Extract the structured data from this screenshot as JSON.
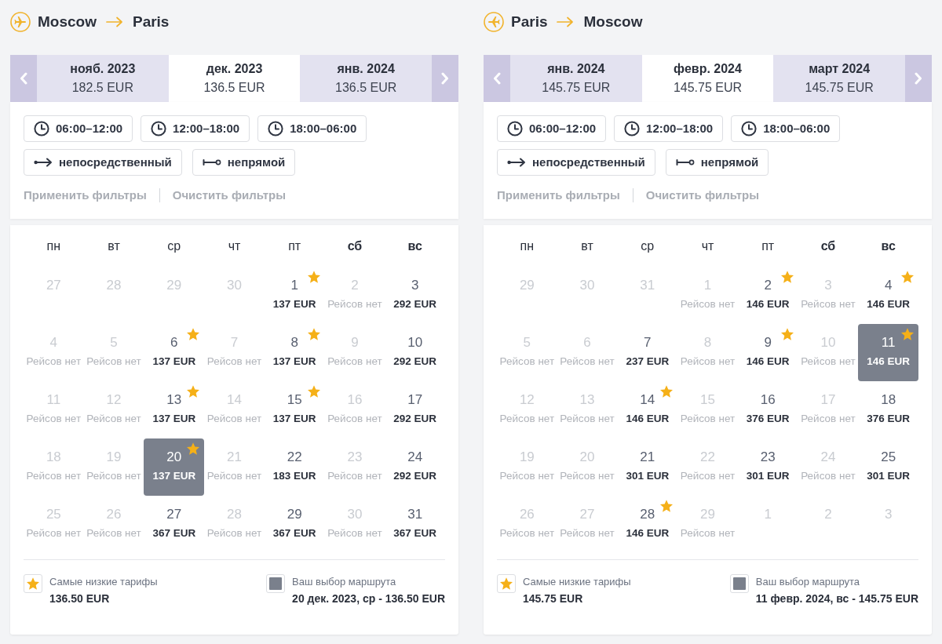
{
  "panels": [
    {
      "kind": "outbound",
      "route": {
        "from": "Moscow",
        "to": "Paris"
      },
      "tabs": [
        {
          "month": "нояб. 2023",
          "price": "182.5 EUR",
          "selected": false
        },
        {
          "month": "дек. 2023",
          "price": "136.5 EUR",
          "selected": true
        },
        {
          "month": "янв. 2024",
          "price": "136.5 EUR",
          "selected": false
        }
      ],
      "time_filters": [
        {
          "kind": "time",
          "label": "06:00–12:00"
        },
        {
          "kind": "time",
          "label": "12:00–18:00"
        },
        {
          "kind": "time",
          "label": "18:00–06:00"
        }
      ],
      "stop_filters": [
        {
          "kind": "direct",
          "label": "непосредственный"
        },
        {
          "kind": "indirect",
          "label": "непрямой"
        }
      ],
      "actions": [
        {
          "label": "Применить фильтры",
          "disabled": true
        },
        {
          "label": "Очистить фильтры",
          "disabled": true
        }
      ],
      "weekdays": [
        {
          "label": "пн",
          "weekend": false
        },
        {
          "label": "вт",
          "weekend": false
        },
        {
          "label": "ср",
          "weekend": false
        },
        {
          "label": "чт",
          "weekend": false
        },
        {
          "label": "пт",
          "weekend": false
        },
        {
          "label": "сб",
          "weekend": true
        },
        {
          "label": "вс",
          "weekend": true
        }
      ],
      "days": [
        {
          "day": "27",
          "kind": "outside",
          "lowest": false,
          "selected": false
        },
        {
          "day": "28",
          "kind": "outside",
          "lowest": false,
          "selected": false
        },
        {
          "day": "29",
          "kind": "outside",
          "lowest": false,
          "selected": false
        },
        {
          "day": "30",
          "kind": "outside",
          "lowest": false,
          "selected": false
        },
        {
          "day": "1",
          "kind": "price",
          "text": "137 EUR",
          "lowest": true,
          "selected": false
        },
        {
          "day": "2",
          "kind": "none",
          "text": "Рейсов нет",
          "lowest": false,
          "selected": false
        },
        {
          "day": "3",
          "kind": "price",
          "text": "292 EUR",
          "lowest": false,
          "selected": false
        },
        {
          "day": "4",
          "kind": "none",
          "text": "Рейсов нет",
          "lowest": false,
          "selected": false
        },
        {
          "day": "5",
          "kind": "none",
          "text": "Рейсов нет",
          "lowest": false,
          "selected": false
        },
        {
          "day": "6",
          "kind": "price",
          "text": "137 EUR",
          "lowest": true,
          "selected": false
        },
        {
          "day": "7",
          "kind": "none",
          "text": "Рейсов нет",
          "lowest": false,
          "selected": false
        },
        {
          "day": "8",
          "kind": "price",
          "text": "137 EUR",
          "lowest": true,
          "selected": false
        },
        {
          "day": "9",
          "kind": "none",
          "text": "Рейсов нет",
          "lowest": false,
          "selected": false
        },
        {
          "day": "10",
          "kind": "price",
          "text": "292 EUR",
          "lowest": false,
          "selected": false
        },
        {
          "day": "11",
          "kind": "none",
          "text": "Рейсов нет",
          "lowest": false,
          "selected": false
        },
        {
          "day": "12",
          "kind": "none",
          "text": "Рейсов нет",
          "lowest": false,
          "selected": false
        },
        {
          "day": "13",
          "kind": "price",
          "text": "137 EUR",
          "lowest": true,
          "selected": false
        },
        {
          "day": "14",
          "kind": "none",
          "text": "Рейсов нет",
          "lowest": false,
          "selected": false
        },
        {
          "day": "15",
          "kind": "price",
          "text": "137 EUR",
          "lowest": true,
          "selected": false
        },
        {
          "day": "16",
          "kind": "none",
          "text": "Рейсов нет",
          "lowest": false,
          "selected": false
        },
        {
          "day": "17",
          "kind": "price",
          "text": "292 EUR",
          "lowest": false,
          "selected": false
        },
        {
          "day": "18",
          "kind": "none",
          "text": "Рейсов нет",
          "lowest": false,
          "selected": false
        },
        {
          "day": "19",
          "kind": "none",
          "text": "Рейсов нет",
          "lowest": false,
          "selected": false
        },
        {
          "day": "20",
          "kind": "price",
          "text": "137 EUR",
          "lowest": true,
          "selected": true
        },
        {
          "day": "21",
          "kind": "none",
          "text": "Рейсов нет",
          "lowest": false,
          "selected": false
        },
        {
          "day": "22",
          "kind": "price",
          "text": "183 EUR",
          "lowest": false,
          "selected": false
        },
        {
          "day": "23",
          "kind": "none",
          "text": "Рейсов нет",
          "lowest": false,
          "selected": false
        },
        {
          "day": "24",
          "kind": "price",
          "text": "292 EUR",
          "lowest": false,
          "selected": false
        },
        {
          "day": "25",
          "kind": "none",
          "text": "Рейсов нет",
          "lowest": false,
          "selected": false
        },
        {
          "day": "26",
          "kind": "none",
          "text": "Рейсов нет",
          "lowest": false,
          "selected": false
        },
        {
          "day": "27",
          "kind": "price",
          "text": "367 EUR",
          "lowest": false,
          "selected": false
        },
        {
          "day": "28",
          "kind": "none",
          "text": "Рейсов нет",
          "lowest": false,
          "selected": false
        },
        {
          "day": "29",
          "kind": "price",
          "text": "367 EUR",
          "lowest": false,
          "selected": false
        },
        {
          "day": "30",
          "kind": "none",
          "text": "Рейсов нет",
          "lowest": false,
          "selected": false
        },
        {
          "day": "31",
          "kind": "price",
          "text": "367 EUR",
          "lowest": false,
          "selected": false
        }
      ],
      "legend": [
        {
          "kind": "lowest",
          "label": "Самые низкие тарифы",
          "value": "136.50 EUR"
        },
        {
          "kind": "selection",
          "label": "Ваш выбор маршрута",
          "value": "20 дек. 2023, ср - 136.50 EUR"
        }
      ]
    },
    {
      "kind": "return",
      "route": {
        "from": "Paris",
        "to": "Moscow"
      },
      "tabs": [
        {
          "month": "янв. 2024",
          "price": "145.75 EUR",
          "selected": false
        },
        {
          "month": "февр. 2024",
          "price": "145.75 EUR",
          "selected": true
        },
        {
          "month": "март 2024",
          "price": "145.75 EUR",
          "selected": false
        }
      ],
      "time_filters": [
        {
          "kind": "time",
          "label": "06:00–12:00"
        },
        {
          "kind": "time",
          "label": "12:00–18:00"
        },
        {
          "kind": "time",
          "label": "18:00–06:00"
        }
      ],
      "stop_filters": [
        {
          "kind": "direct",
          "label": "непосредственный"
        },
        {
          "kind": "indirect",
          "label": "непрямой"
        }
      ],
      "actions": [
        {
          "label": "Применить фильтры",
          "disabled": true
        },
        {
          "label": "Очистить фильтры",
          "disabled": true
        }
      ],
      "weekdays": [
        {
          "label": "пн",
          "weekend": false
        },
        {
          "label": "вт",
          "weekend": false
        },
        {
          "label": "ср",
          "weekend": false
        },
        {
          "label": "чт",
          "weekend": false
        },
        {
          "label": "пт",
          "weekend": false
        },
        {
          "label": "сб",
          "weekend": true
        },
        {
          "label": "вс",
          "weekend": true
        }
      ],
      "days": [
        {
          "day": "29",
          "kind": "outside",
          "lowest": false,
          "selected": false
        },
        {
          "day": "30",
          "kind": "outside",
          "lowest": false,
          "selected": false
        },
        {
          "day": "31",
          "kind": "outside",
          "lowest": false,
          "selected": false
        },
        {
          "day": "1",
          "kind": "none",
          "text": "Рейсов нет",
          "lowest": false,
          "selected": false
        },
        {
          "day": "2",
          "kind": "price",
          "text": "146 EUR",
          "lowest": true,
          "selected": false
        },
        {
          "day": "3",
          "kind": "none",
          "text": "Рейсов нет",
          "lowest": false,
          "selected": false
        },
        {
          "day": "4",
          "kind": "price",
          "text": "146 EUR",
          "lowest": true,
          "selected": false
        },
        {
          "day": "5",
          "kind": "none",
          "text": "Рейсов нет",
          "lowest": false,
          "selected": false
        },
        {
          "day": "6",
          "kind": "none",
          "text": "Рейсов нет",
          "lowest": false,
          "selected": false
        },
        {
          "day": "7",
          "kind": "price",
          "text": "237 EUR",
          "lowest": false,
          "selected": false
        },
        {
          "day": "8",
          "kind": "none",
          "text": "Рейсов нет",
          "lowest": false,
          "selected": false
        },
        {
          "day": "9",
          "kind": "price",
          "text": "146 EUR",
          "lowest": true,
          "selected": false
        },
        {
          "day": "10",
          "kind": "none",
          "text": "Рейсов нет",
          "lowest": false,
          "selected": false
        },
        {
          "day": "11",
          "kind": "price",
          "text": "146 EUR",
          "lowest": true,
          "selected": true
        },
        {
          "day": "12",
          "kind": "none",
          "text": "Рейсов нет",
          "lowest": false,
          "selected": false
        },
        {
          "day": "13",
          "kind": "none",
          "text": "Рейсов нет",
          "lowest": false,
          "selected": false
        },
        {
          "day": "14",
          "kind": "price",
          "text": "146 EUR",
          "lowest": true,
          "selected": false
        },
        {
          "day": "15",
          "kind": "none",
          "text": "Рейсов нет",
          "lowest": false,
          "selected": false
        },
        {
          "day": "16",
          "kind": "price",
          "text": "376 EUR",
          "lowest": false,
          "selected": false
        },
        {
          "day": "17",
          "kind": "none",
          "text": "Рейсов нет",
          "lowest": false,
          "selected": false
        },
        {
          "day": "18",
          "kind": "price",
          "text": "376 EUR",
          "lowest": false,
          "selected": false
        },
        {
          "day": "19",
          "kind": "none",
          "text": "Рейсов нет",
          "lowest": false,
          "selected": false
        },
        {
          "day": "20",
          "kind": "none",
          "text": "Рейсов нет",
          "lowest": false,
          "selected": false
        },
        {
          "day": "21",
          "kind": "price",
          "text": "301 EUR",
          "lowest": false,
          "selected": false
        },
        {
          "day": "22",
          "kind": "none",
          "text": "Рейсов нет",
          "lowest": false,
          "selected": false
        },
        {
          "day": "23",
          "kind": "price",
          "text": "301 EUR",
          "lowest": false,
          "selected": false
        },
        {
          "day": "24",
          "kind": "none",
          "text": "Рейсов нет",
          "lowest": false,
          "selected": false
        },
        {
          "day": "25",
          "kind": "price",
          "text": "301 EUR",
          "lowest": false,
          "selected": false
        },
        {
          "day": "26",
          "kind": "none",
          "text": "Рейсов нет",
          "lowest": false,
          "selected": false
        },
        {
          "day": "27",
          "kind": "none",
          "text": "Рейсов нет",
          "lowest": false,
          "selected": false
        },
        {
          "day": "28",
          "kind": "price",
          "text": "146 EUR",
          "lowest": true,
          "selected": false
        },
        {
          "day": "29",
          "kind": "none",
          "text": "Рейсов нет",
          "lowest": false,
          "selected": false
        },
        {
          "day": "1",
          "kind": "outside",
          "lowest": false,
          "selected": false
        },
        {
          "day": "2",
          "kind": "outside",
          "lowest": false,
          "selected": false
        },
        {
          "day": "3",
          "kind": "outside",
          "lowest": false,
          "selected": false
        }
      ],
      "legend": [
        {
          "kind": "lowest",
          "label": "Самые низкие тарифы",
          "value": "145.75 EUR"
        },
        {
          "kind": "selection",
          "label": "Ваш выбор маршрута",
          "value": "11 февр. 2024, вс - 145.75 EUR"
        }
      ]
    }
  ]
}
